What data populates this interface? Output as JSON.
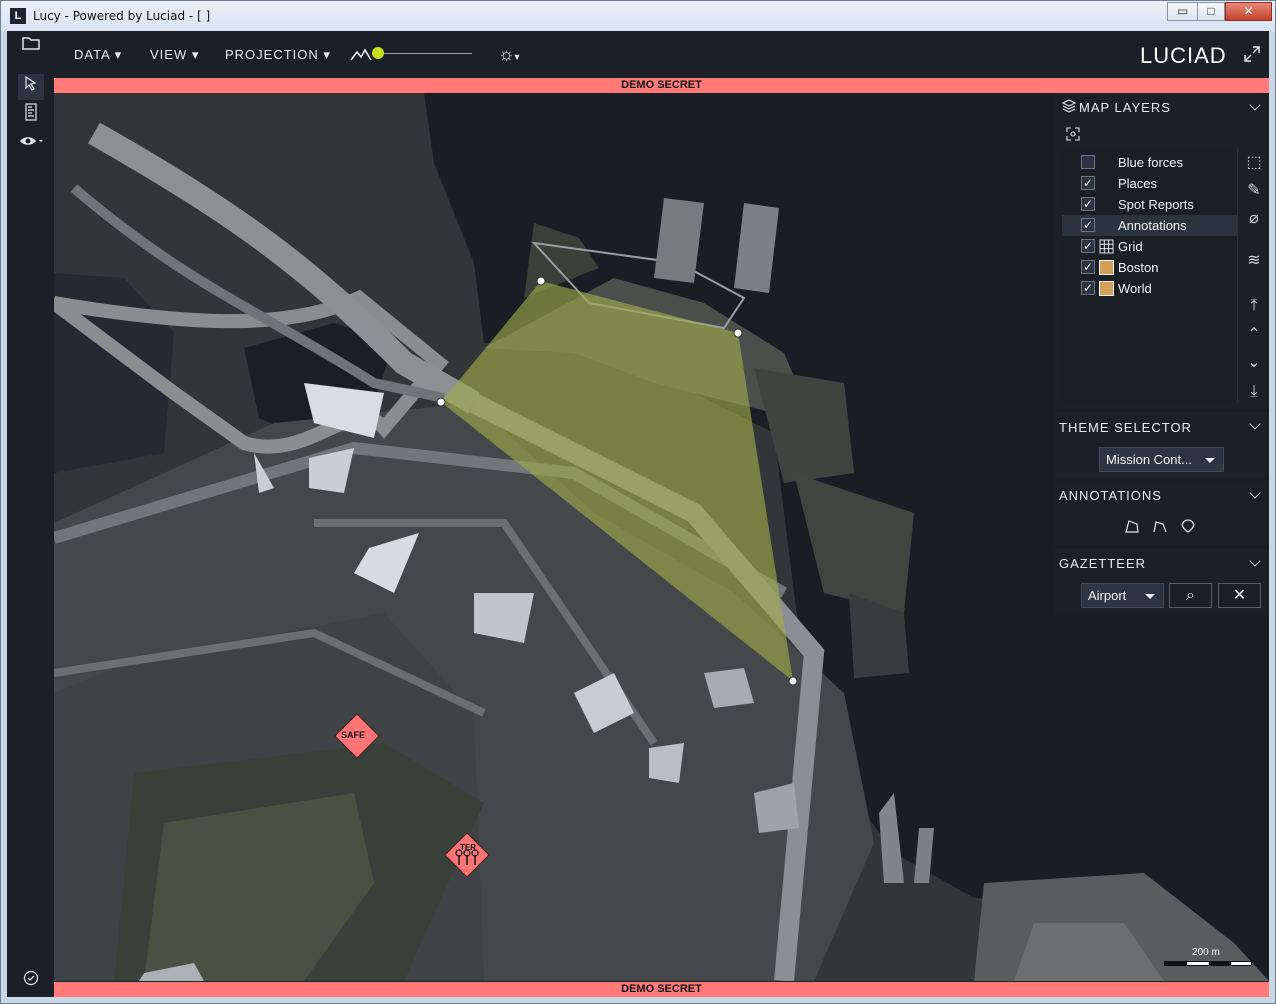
{
  "window": {
    "title": "Lucy - Powered by Luciad - [ ]",
    "app_icon": "L",
    "minimize": "▭",
    "maximize": "□",
    "close": "✕"
  },
  "menu": {
    "data": "DATA",
    "view": "VIEW",
    "projection": "PROJECTION",
    "logo": "LUCIAD",
    "expand_icon": "expand-icon"
  },
  "classification": {
    "top": "DEMO SECRET",
    "bottom": "DEMO SECRET"
  },
  "map_layers": {
    "title": "MAP LAYERS",
    "items": [
      {
        "label": "Blue forces",
        "checked": false,
        "icon": ""
      },
      {
        "label": "Places",
        "checked": true,
        "icon": ""
      },
      {
        "label": "Spot Reports",
        "checked": true,
        "icon": ""
      },
      {
        "label": "Annotations",
        "checked": true,
        "icon": ""
      },
      {
        "label": "Grid",
        "checked": true,
        "icon": "grid-icon"
      },
      {
        "label": "Boston",
        "checked": true,
        "icon": "image-layer-icon"
      },
      {
        "label": "World",
        "checked": true,
        "icon": "image-layer-icon"
      }
    ]
  },
  "theme_selector": {
    "title": "THEME SELECTOR",
    "value": "Mission Cont..."
  },
  "annotations": {
    "title": "ANNOTATIONS"
  },
  "gazetteer": {
    "title": "GAZETTEER",
    "value": "Airport"
  },
  "map": {
    "safe_label": "SAFE",
    "ter_label": "TER",
    "scale_label": "200 m"
  },
  "colors": {
    "classification_banner": "#ff7a78",
    "polygon_fill": "#a1ad4a",
    "marker_fill": "#ff7474",
    "slider_knob": "#c8e020"
  }
}
